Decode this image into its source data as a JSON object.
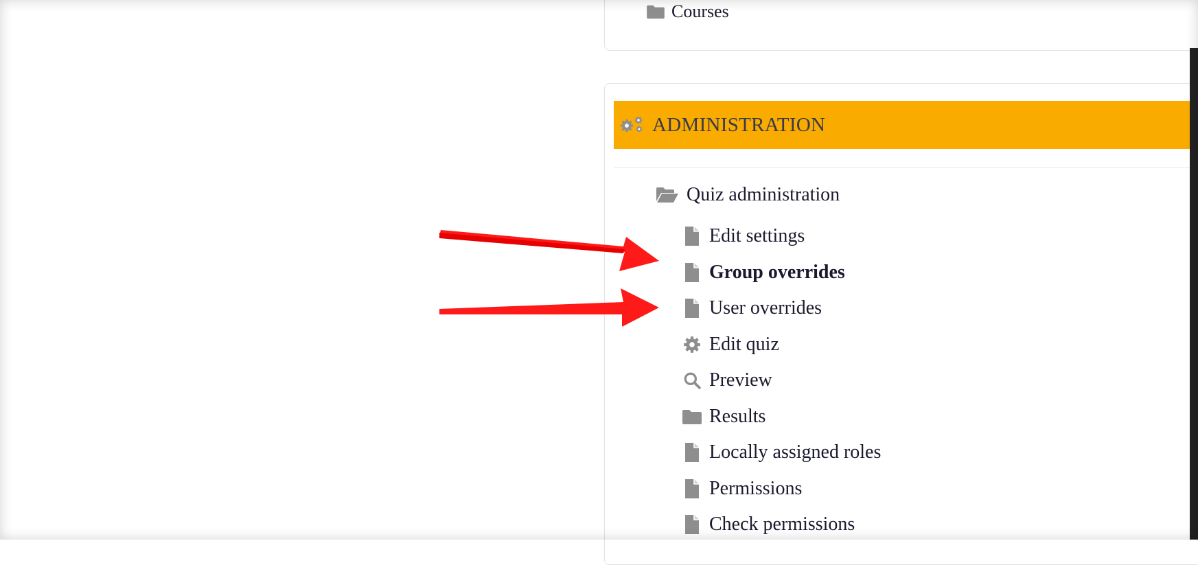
{
  "courses_block": {
    "label": "Courses",
    "icon": "folder-icon"
  },
  "admin_block": {
    "title": "ADMINISTRATION",
    "header_color": "#f9ab00",
    "icon": "gears-icon",
    "parent": {
      "label": "Quiz administration",
      "icon": "folder-open-icon"
    },
    "items": [
      {
        "label": "Edit settings",
        "icon": "file-icon",
        "active": false
      },
      {
        "label": "Group overrides",
        "icon": "file-icon",
        "active": true
      },
      {
        "label": "User overrides",
        "icon": "file-icon",
        "active": false
      },
      {
        "label": "Edit quiz",
        "icon": "gear-icon",
        "active": false
      },
      {
        "label": "Preview",
        "icon": "search-icon",
        "active": false
      },
      {
        "label": "Results",
        "icon": "folder-icon",
        "active": false
      },
      {
        "label": "Locally assigned roles",
        "icon": "file-icon",
        "active": false
      },
      {
        "label": "Permissions",
        "icon": "file-icon",
        "active": false
      },
      {
        "label": "Check permissions",
        "icon": "file-icon",
        "active": false
      }
    ]
  },
  "annotation_color": "#ff1a1a"
}
